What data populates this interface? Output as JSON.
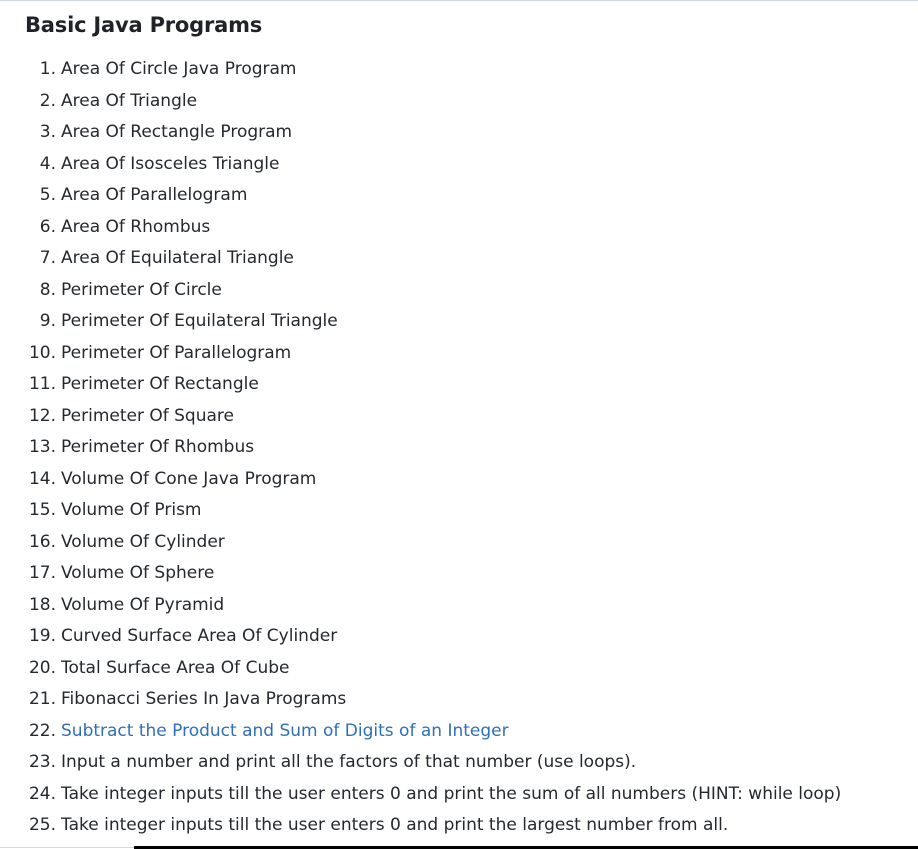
{
  "page": {
    "heading": "Basic Java Programs",
    "link_color": "#2f6fba",
    "text_color": "#24292f"
  },
  "programs": [
    {
      "num": "1.",
      "text": "Area Of Circle Java Program",
      "is_link": false
    },
    {
      "num": "2.",
      "text": "Area Of Triangle",
      "is_link": false
    },
    {
      "num": "3.",
      "text": "Area Of Rectangle Program",
      "is_link": false
    },
    {
      "num": "4.",
      "text": "Area Of Isosceles Triangle",
      "is_link": false
    },
    {
      "num": "5.",
      "text": "Area Of Parallelogram",
      "is_link": false
    },
    {
      "num": "6.",
      "text": "Area Of Rhombus",
      "is_link": false
    },
    {
      "num": "7.",
      "text": "Area Of Equilateral Triangle",
      "is_link": false
    },
    {
      "num": "8.",
      "text": "Perimeter Of Circle",
      "is_link": false
    },
    {
      "num": "9.",
      "text": "Perimeter Of Equilateral Triangle",
      "is_link": false
    },
    {
      "num": "10.",
      "text": "Perimeter Of Parallelogram",
      "is_link": false
    },
    {
      "num": "11.",
      "text": "Perimeter Of Rectangle",
      "is_link": false
    },
    {
      "num": "12.",
      "text": "Perimeter Of Square",
      "is_link": false
    },
    {
      "num": "13.",
      "text": "Perimeter Of Rhombus",
      "is_link": false
    },
    {
      "num": "14.",
      "text": "Volume Of Cone Java Program",
      "is_link": false
    },
    {
      "num": "15.",
      "text": "Volume Of Prism",
      "is_link": false
    },
    {
      "num": "16.",
      "text": "Volume Of Cylinder",
      "is_link": false
    },
    {
      "num": "17.",
      "text": "Volume Of Sphere",
      "is_link": false
    },
    {
      "num": "18.",
      "text": "Volume Of Pyramid",
      "is_link": false
    },
    {
      "num": "19.",
      "text": "Curved Surface Area Of Cylinder",
      "is_link": false
    },
    {
      "num": "20.",
      "text": "Total Surface Area Of Cube",
      "is_link": false
    },
    {
      "num": "21.",
      "text": "Fibonacci Series In Java Programs",
      "is_link": false
    },
    {
      "num": "22.",
      "text": "Subtract the Product and Sum of Digits of an Integer",
      "is_link": true
    },
    {
      "num": "23.",
      "text": "Input a number and print all the factors of that number (use loops).",
      "is_link": false
    },
    {
      "num": "24.",
      "text": "Take integer inputs till the user enters 0 and print the sum of all numbers (HINT: while loop)",
      "is_link": false
    },
    {
      "num": "25.",
      "text": "Take integer inputs till the user enters 0 and print the largest number from all.",
      "is_link": false
    }
  ]
}
